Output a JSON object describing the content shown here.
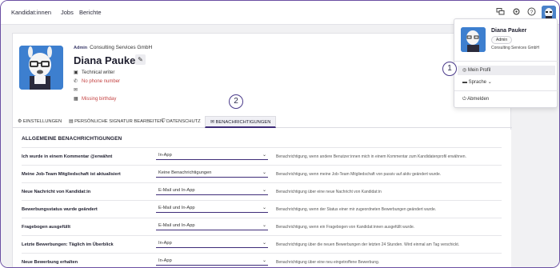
{
  "topnav": {
    "links": [
      "Kandidat:innen",
      "Jobs",
      "Berichte"
    ]
  },
  "profile": {
    "company_badge": "Admin",
    "company": "Consulting Services GmbH",
    "name": "Diana Pauker",
    "title": "Technical writer",
    "phone": "No phone number",
    "birthday": "Missing birthday"
  },
  "tabs": [
    {
      "label": "EINSTELLUNGEN",
      "icon": "gear-icon"
    },
    {
      "label": "PERSÖNLICHE SIGNATUR BEARBEITEN",
      "icon": "signature-icon"
    },
    {
      "label": "DATENSCHUTZ",
      "icon": "shield-icon"
    },
    {
      "label": "BENACHRICHTIGUNGEN",
      "icon": "envelope-icon"
    }
  ],
  "section": {
    "title": "ALLGEMEINE BENACHRICHTIGUNGEN",
    "rows": [
      {
        "label": "Ich wurde in einem Kommentar @erwähnt",
        "value": "In-App",
        "desc": "Benachrichtigung, wenn andere Benutzer:innen mich in einem Kommentar zum Kandidatenprofil erwähnen."
      },
      {
        "label": "Meine Job-Team Mitgliedschaft ist aktualisiert",
        "value": "Keine Benachrichtigungen",
        "desc": "Benachrichtigung, wenn meine Job-Team Mitgliedschaft von passiv auf aktiv geändert wurde."
      },
      {
        "label": "Neue Nachricht von Kandidat:in",
        "value": "E-Mail und In-App",
        "desc": "Benachrichtigung über eine neue Nachricht von Kandidat:in"
      },
      {
        "label": "Bewerbungsstatus wurde geändert",
        "value": "E-Mail und In-App",
        "desc": "Benachrichtigung, wenn der Status einer mir zugeordneten Bewerbungen geändert wurde."
      },
      {
        "label": "Fragebogen ausgefüllt",
        "value": "E-Mail und In-App",
        "desc": "Benachrichtigung, wenn ein Fragebogen von Kandidat:innen ausgefüllt wurde."
      },
      {
        "label": "Letzte Bewerbungen: Täglich im Überblick",
        "value": "In-App",
        "desc": "Benachrichtigung über die neuen Bewerbungen der letzten 24 Stunden. Wird einmal am Tag verschickt."
      },
      {
        "label": "Neue Bewerbung erhalten",
        "value": "In-App",
        "desc": "Benachrichtigung über eine neu eingetroffene Bewerbung."
      }
    ]
  },
  "dropdown": {
    "name": "Diana Pauker",
    "badge": "Admin",
    "company": "Consulting Services GmbH",
    "items": [
      "Mein Profil",
      "Sprache",
      "Abmelden"
    ]
  },
  "callouts": [
    "1",
    "2"
  ]
}
